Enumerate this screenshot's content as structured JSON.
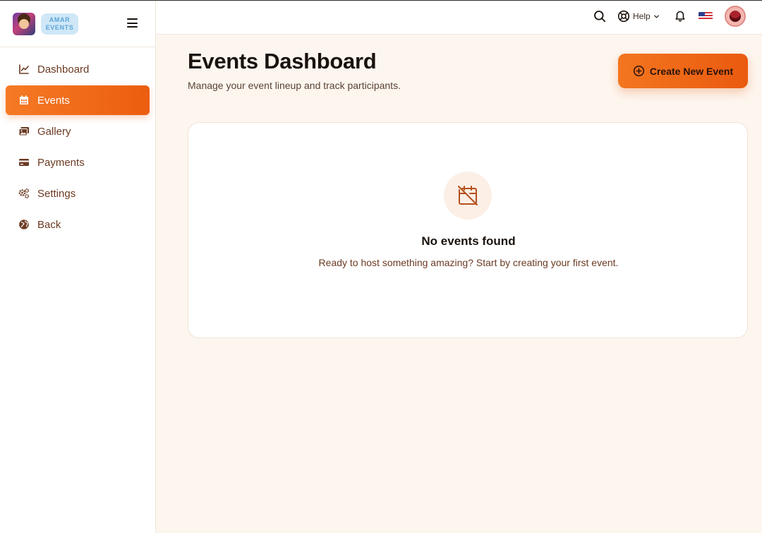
{
  "brand": {
    "line1": "AMAR",
    "line2": "EVENTS",
    "logo_icon": "mascot-avatar"
  },
  "sidebar": {
    "items": [
      {
        "label": "Dashboard",
        "icon": "line-chart-icon",
        "active": false
      },
      {
        "label": "Events",
        "icon": "calendar-icon",
        "active": true
      },
      {
        "label": "Gallery",
        "icon": "images-icon",
        "active": false
      },
      {
        "label": "Payments",
        "icon": "credit-card-icon",
        "active": false
      },
      {
        "label": "Settings",
        "icon": "gears-icon",
        "active": false
      },
      {
        "label": "Back",
        "icon": "globe-icon",
        "active": false
      }
    ]
  },
  "header": {
    "help_label": "Help",
    "language_icon": "us-flag-icon"
  },
  "main": {
    "title": "Events Dashboard",
    "subtitle": "Manage your event lineup and track participants.",
    "create_button_label": "Create New Event"
  },
  "empty_state": {
    "title": "No events found",
    "description": "Ready to host something amazing? Start by creating your first event.",
    "icon": "calendar-off-icon"
  },
  "colors": {
    "accent": "#ec5d0f",
    "accent_light": "#f57a25",
    "background": "#fdf6ef",
    "nav_text": "#6b3a22"
  }
}
